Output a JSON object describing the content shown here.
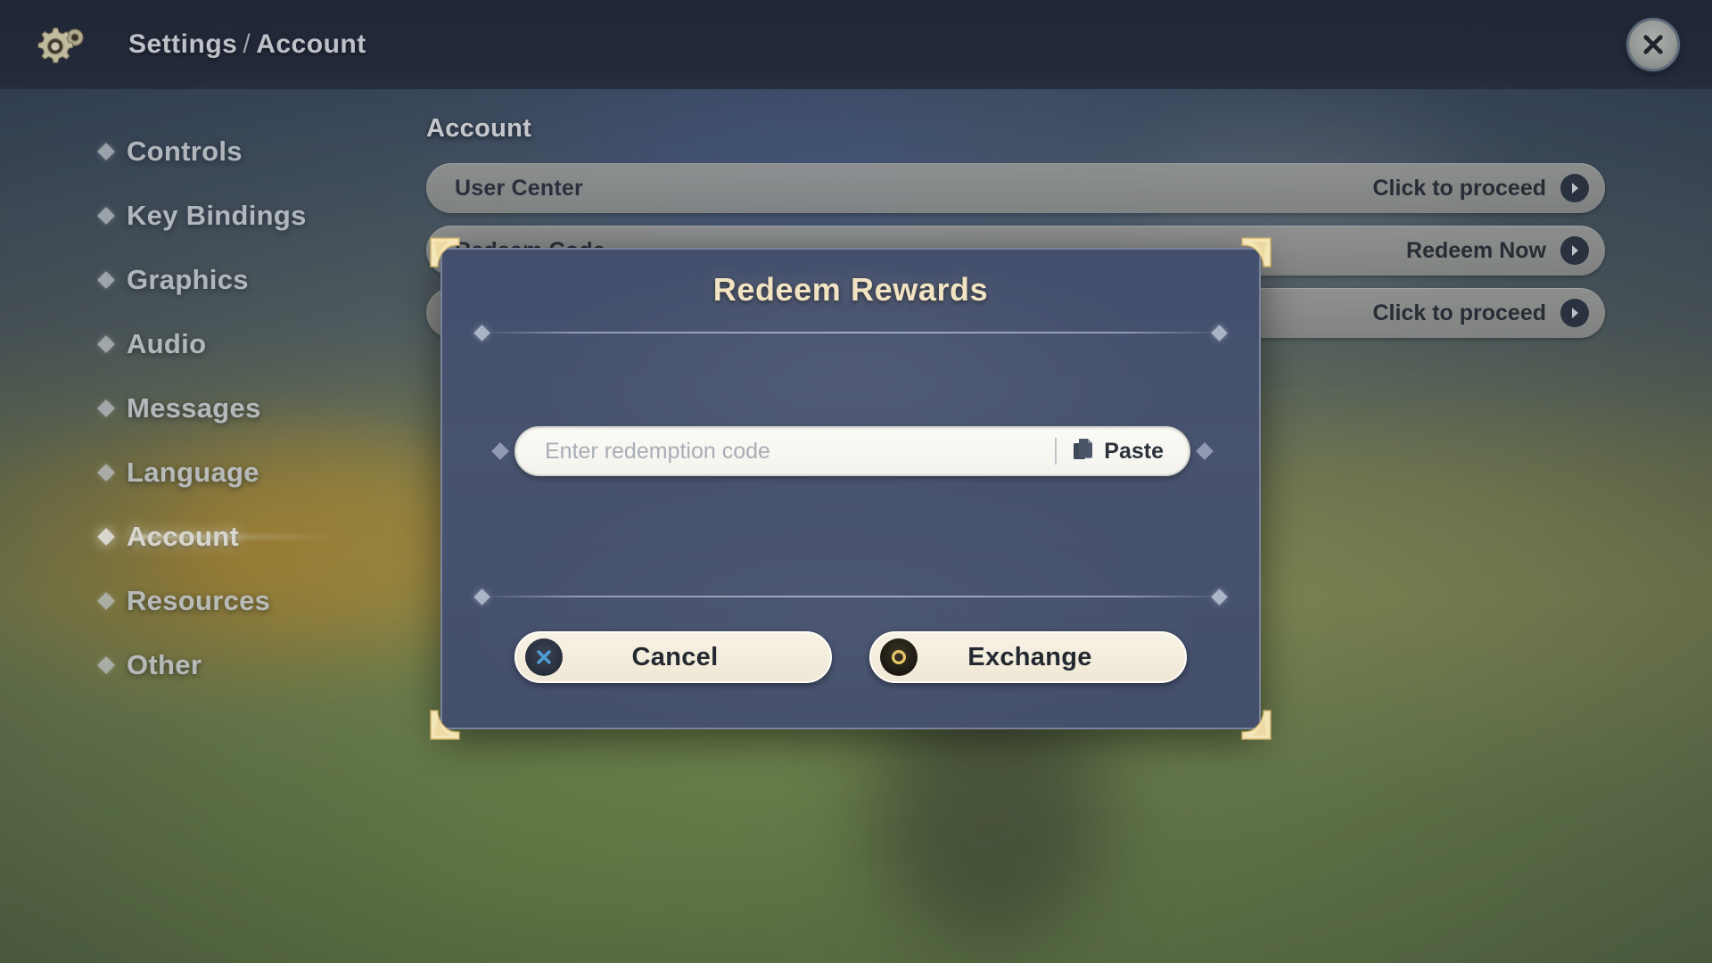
{
  "topbar": {
    "gear_icon": "gear-icon",
    "breadcrumb_root": "Settings",
    "breadcrumb_sep": "/",
    "breadcrumb_current": "Account",
    "close_icon": "close-x-icon"
  },
  "sidebar": {
    "items": [
      {
        "label": "Controls",
        "selected": false
      },
      {
        "label": "Key Bindings",
        "selected": false
      },
      {
        "label": "Graphics",
        "selected": false
      },
      {
        "label": "Audio",
        "selected": false
      },
      {
        "label": "Messages",
        "selected": false
      },
      {
        "label": "Language",
        "selected": false
      },
      {
        "label": "Account",
        "selected": true
      },
      {
        "label": "Resources",
        "selected": false
      },
      {
        "label": "Other",
        "selected": false
      }
    ]
  },
  "panel": {
    "title": "Account",
    "rows": [
      {
        "label": "User Center",
        "action": "Click to proceed",
        "action_icon": "chevron-right-icon"
      },
      {
        "label": "Redeem Code",
        "action": "Redeem Now",
        "action_icon": "chevron-right-icon"
      },
      {
        "label": "",
        "action": "Click to proceed",
        "action_icon": "chevron-right-icon"
      }
    ]
  },
  "dialog": {
    "title": "Redeem Rewards",
    "input": {
      "value": "",
      "placeholder": "Enter redemption code"
    },
    "paste": {
      "label": "Paste",
      "icon": "clipboard-paste-icon"
    },
    "buttons": [
      {
        "label": "Cancel",
        "glyph": "cross-button-icon",
        "glyph_char": "✕",
        "glyph_color": "#4e9fd4"
      },
      {
        "label": "Exchange",
        "glyph": "circle-button-icon",
        "glyph_char": "○",
        "glyph_color": "#e8c766"
      }
    ]
  },
  "colors": {
    "dialog_bg": "#454f6d",
    "gold": "#f2e4c2",
    "corner_gold": "#f5e6b8",
    "row_bg": "#b0b0aa",
    "button_cream": "#f4efe0"
  }
}
